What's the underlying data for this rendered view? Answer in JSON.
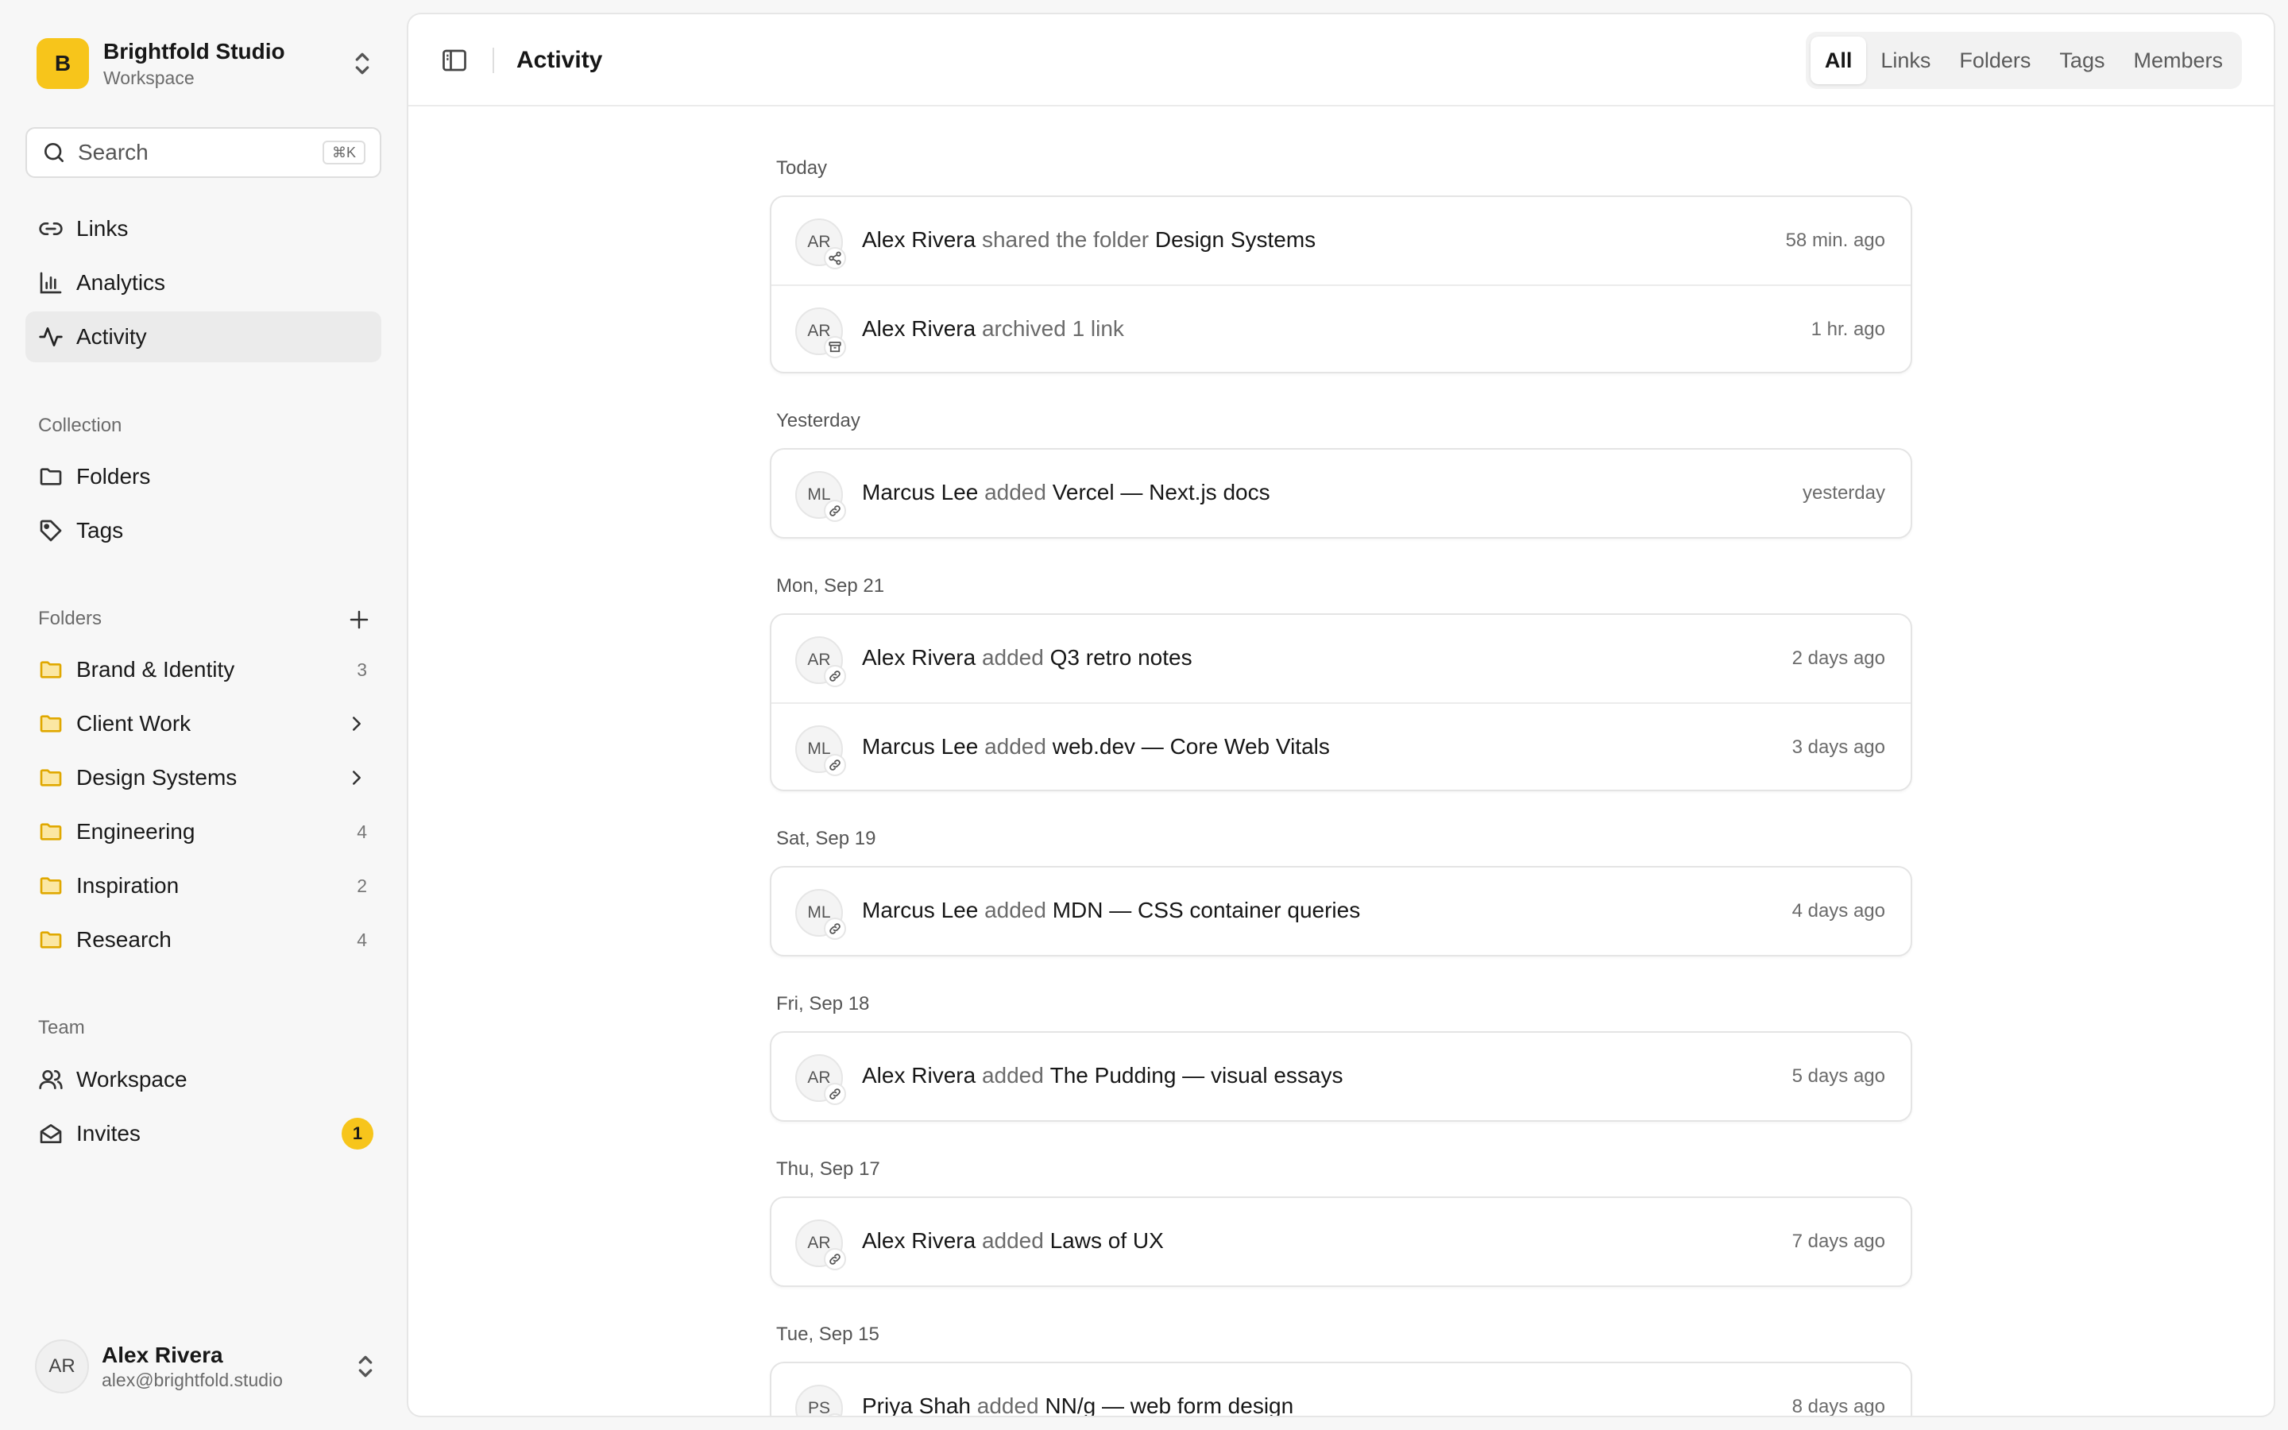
{
  "workspace": {
    "initial": "B",
    "name": "Brightfold Studio",
    "subtitle": "Workspace"
  },
  "search": {
    "placeholder": "Search",
    "shortcut": "⌘K"
  },
  "nav": [
    {
      "label": "Links",
      "icon": "link-icon"
    },
    {
      "label": "Analytics",
      "icon": "bar-chart-icon"
    },
    {
      "label": "Activity",
      "icon": "activity-icon",
      "active": true
    }
  ],
  "collection": {
    "title": "Collection",
    "items": [
      {
        "label": "Folders",
        "icon": "folder-icon"
      },
      {
        "label": "Tags",
        "icon": "tag-icon"
      }
    ]
  },
  "folders": {
    "title": "Folders",
    "items": [
      {
        "label": "Brand & Identity",
        "count": "3"
      },
      {
        "label": "Client Work",
        "expandable": true
      },
      {
        "label": "Design Systems",
        "expandable": true
      },
      {
        "label": "Engineering",
        "count": "4"
      },
      {
        "label": "Inspiration",
        "count": "2"
      },
      {
        "label": "Research",
        "count": "4"
      }
    ]
  },
  "team": {
    "title": "Team",
    "items": [
      {
        "label": "Workspace",
        "icon": "users-icon"
      },
      {
        "label": "Invites",
        "icon": "mail-open-icon",
        "badge": "1"
      }
    ]
  },
  "user": {
    "initials": "AR",
    "name": "Alex Rivera",
    "email": "alex@brightfold.studio"
  },
  "header": {
    "title": "Activity"
  },
  "tabs": [
    {
      "label": "All",
      "active": true
    },
    {
      "label": "Links"
    },
    {
      "label": "Folders"
    },
    {
      "label": "Tags"
    },
    {
      "label": "Members"
    }
  ],
  "activity": [
    {
      "day": "Today",
      "events": [
        {
          "initials": "AR",
          "actor": "Alex Rivera",
          "verb": "shared the folder",
          "target": "Design Systems",
          "time": "58 min. ago",
          "icon": "share-icon"
        },
        {
          "initials": "AR",
          "actor": "Alex Rivera",
          "verb": "archived 1 link",
          "target": "",
          "time": "1 hr. ago",
          "icon": "archive-icon"
        }
      ]
    },
    {
      "day": "Yesterday",
      "events": [
        {
          "initials": "ML",
          "actor": "Marcus Lee",
          "verb": "added",
          "target": "Vercel — Next.js docs",
          "time": "yesterday",
          "icon": "link-icon"
        }
      ]
    },
    {
      "day": "Mon, Sep 21",
      "events": [
        {
          "initials": "AR",
          "actor": "Alex Rivera",
          "verb": "added",
          "target": "Q3 retro notes",
          "time": "2 days ago",
          "icon": "link-icon"
        },
        {
          "initials": "ML",
          "actor": "Marcus Lee",
          "verb": "added",
          "target": "web.dev — Core Web Vitals",
          "time": "3 days ago",
          "icon": "link-icon"
        }
      ]
    },
    {
      "day": "Sat, Sep 19",
      "events": [
        {
          "initials": "ML",
          "actor": "Marcus Lee",
          "verb": "added",
          "target": "MDN — CSS container queries",
          "time": "4 days ago",
          "icon": "link-icon"
        }
      ]
    },
    {
      "day": "Fri, Sep 18",
      "events": [
        {
          "initials": "AR",
          "actor": "Alex Rivera",
          "verb": "added",
          "target": "The Pudding — visual essays",
          "time": "5 days ago",
          "icon": "link-icon"
        }
      ]
    },
    {
      "day": "Thu, Sep 17",
      "events": [
        {
          "initials": "AR",
          "actor": "Alex Rivera",
          "verb": "added",
          "target": "Laws of UX",
          "time": "7 days ago",
          "icon": "link-icon"
        }
      ]
    },
    {
      "day": "Tue, Sep 15",
      "events": [
        {
          "initials": "PS",
          "actor": "Priya Shah",
          "verb": "added",
          "target": "NN/g — web form design",
          "time": "8 days ago",
          "icon": "link-icon"
        }
      ]
    }
  ]
}
